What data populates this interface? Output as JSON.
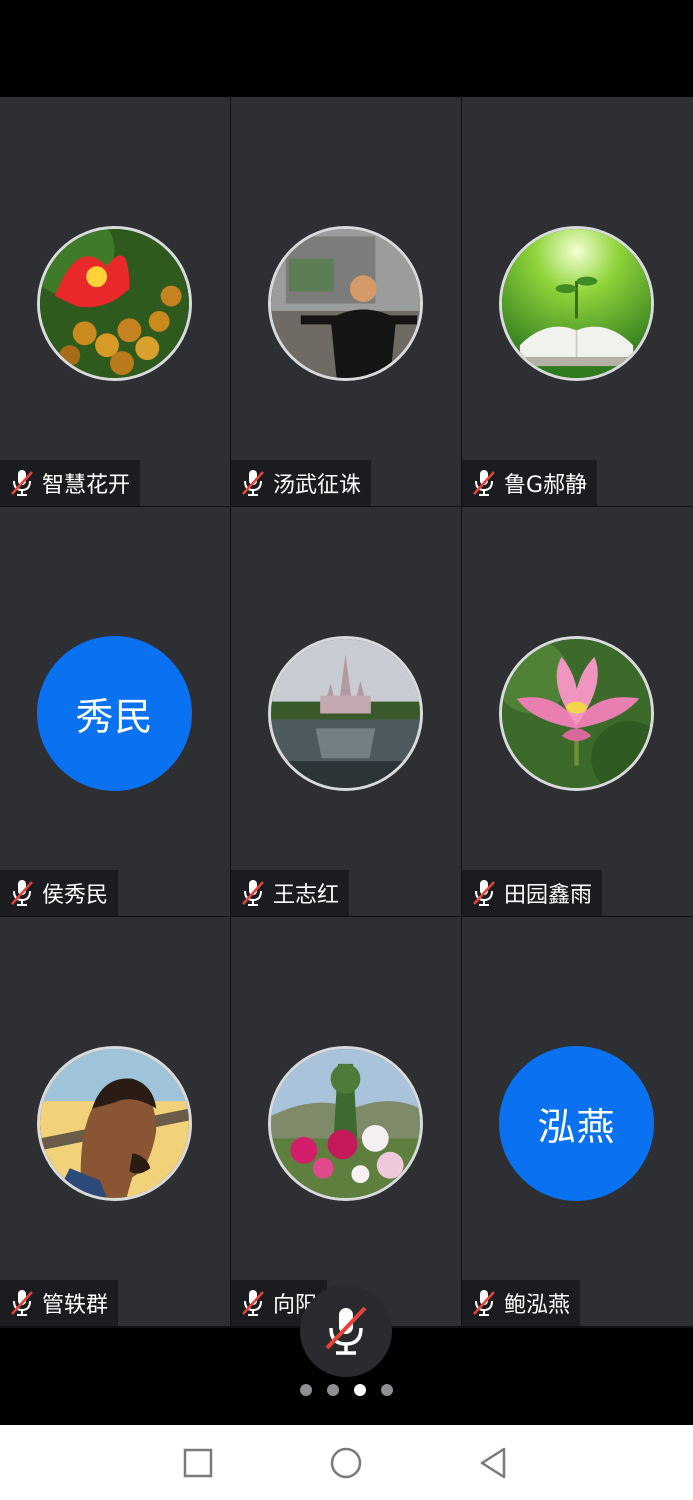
{
  "participants": [
    {
      "name": "智慧花开",
      "muted": true,
      "avatar": "flower-fruit-photo"
    },
    {
      "name": "汤武征诛",
      "muted": true,
      "avatar": "man-photo"
    },
    {
      "name": "鲁G郝静",
      "muted": true,
      "avatar": "book-plant-photo"
    },
    {
      "name": "侯秀民",
      "muted": true,
      "avatar_text": "秀民",
      "avatar_color": "#0a72f0"
    },
    {
      "name": "王志红",
      "muted": true,
      "avatar": "castle-photo"
    },
    {
      "name": "田园鑫雨",
      "muted": true,
      "avatar": "lotus-photo"
    },
    {
      "name": "管轶群",
      "muted": true,
      "avatar": "basketball-player-art"
    },
    {
      "name": "向阳",
      "muted": true,
      "avatar": "pink-flowers-photo"
    },
    {
      "name": "鲍泓燕",
      "muted": true,
      "avatar_text": "泓燕",
      "avatar_color": "#0a72f0"
    }
  ],
  "pager": {
    "pages": 4,
    "current": 3
  },
  "mute_button": {
    "icon": "mic-muted-icon",
    "state": "muted"
  },
  "colors": {
    "tile_bg": "#2d2f33",
    "accent": "#0a72f0",
    "mute_slash": "#e5423a"
  },
  "system_nav": [
    {
      "icon": "square-recents-icon"
    },
    {
      "icon": "circle-home-icon"
    },
    {
      "icon": "triangle-back-icon"
    }
  ]
}
